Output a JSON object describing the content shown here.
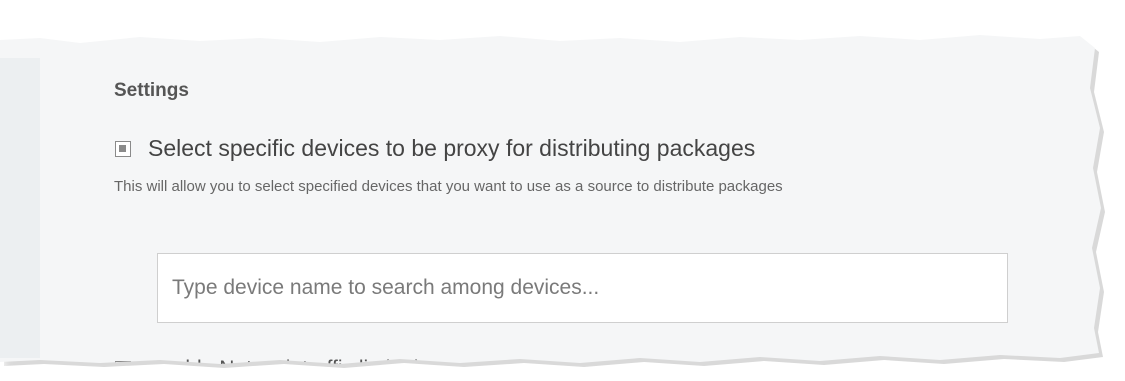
{
  "settings": {
    "title": "Settings",
    "proxy_devices": {
      "checked": true,
      "label": "Select specific devices to be proxy for distributing packages",
      "description": "This will allow you to select specified devices that you want to use as a source to distribute packages"
    },
    "device_search": {
      "value": "",
      "placeholder": "Type device name to search among devices..."
    },
    "network_limit": {
      "checked": false,
      "label": "Enable Network traffic limitation"
    }
  }
}
